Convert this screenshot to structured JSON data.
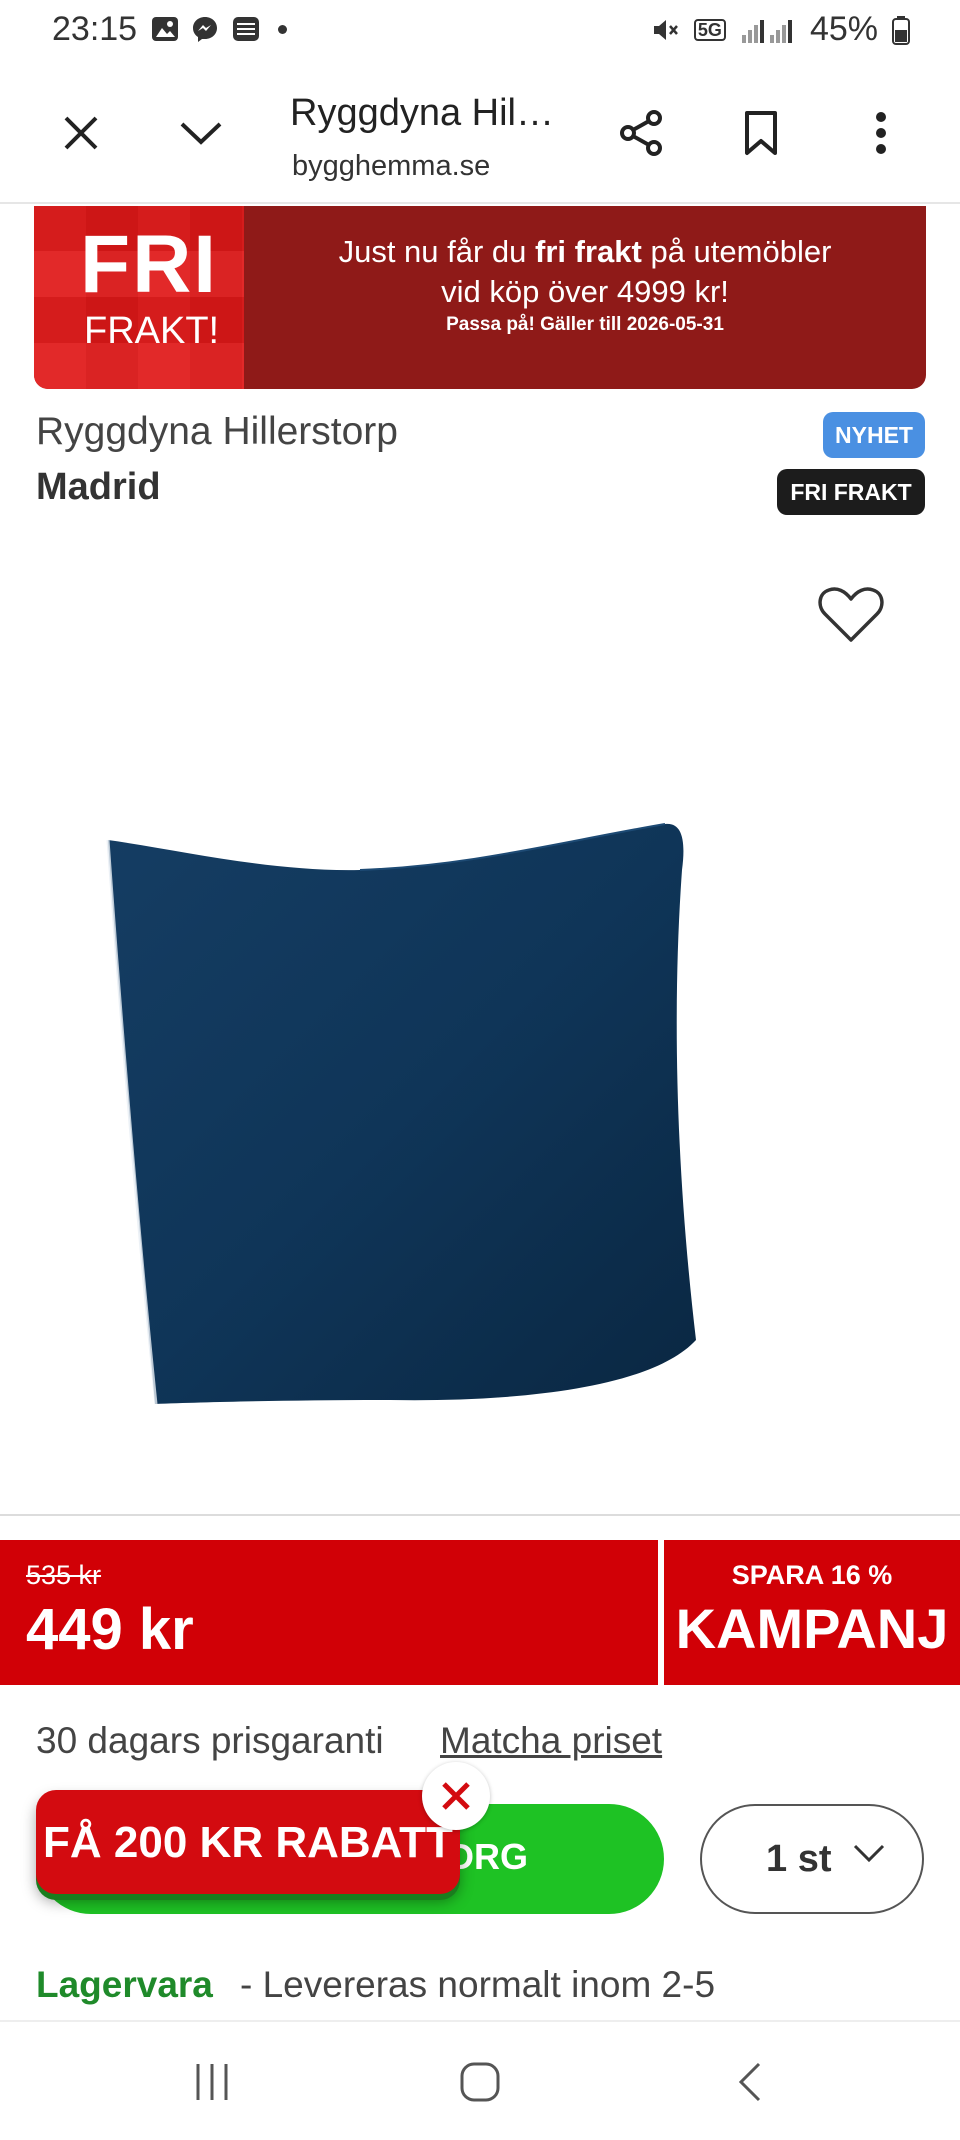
{
  "status_bar": {
    "time": "23:15",
    "battery": "45%",
    "network": "5G",
    "notification_icons": [
      "image-icon",
      "messenger-icon",
      "stack-icon"
    ]
  },
  "browser": {
    "title": "Ryggdyna Hil…",
    "domain": "bygghemma.se",
    "icons": [
      "close-icon",
      "chevron-down-icon",
      "share-icon",
      "bookmark-icon",
      "more-vert-icon"
    ]
  },
  "banner": {
    "fri": "FRI",
    "frakt": "FRAKT!",
    "line1_pre": "Just nu får du ",
    "line1_bold": "fri frakt",
    "line1_post": " på utemöbler",
    "line2": "vid köp över 4999 kr!",
    "line3": "Passa på! Gäller till 2026-05-31"
  },
  "product": {
    "name": "Ryggdyna Hillerstorp",
    "brand": "Madrid",
    "badge_new": "NYHET",
    "badge_free": "FRI FRAKT"
  },
  "price": {
    "old": "535 kr",
    "current": "449 kr",
    "save": "SPARA 16 %",
    "campaign": "KAMPANJ"
  },
  "guarantee": {
    "text": "30 dagars prisgaranti",
    "link": "Matcha priset"
  },
  "cart": {
    "button_label": "DRG",
    "quantity": "1 st"
  },
  "promo": {
    "label": "FÅ 200 KR RABATT"
  },
  "stock": {
    "status": "Lagervara",
    "delivery": "- Levereras normalt inom 2-5"
  },
  "colors": {
    "banner_red": "#d10006",
    "cta_green": "#1ec224",
    "badge_blue": "#4a90e2",
    "stock_green": "#1f8a2a",
    "pillow_blue": "#0f3558"
  }
}
